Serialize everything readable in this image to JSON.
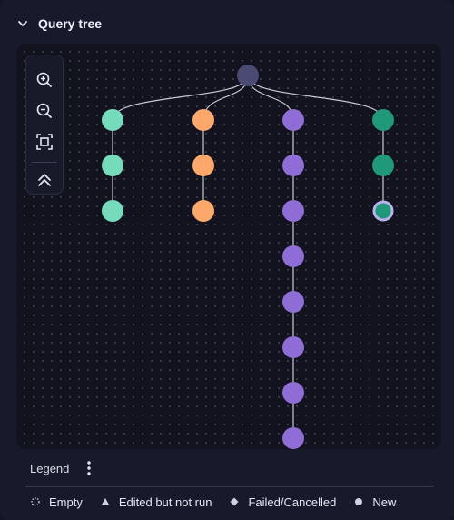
{
  "panel": {
    "title": "Query tree"
  },
  "legend": {
    "title": "Legend",
    "items": [
      {
        "key": "empty",
        "label": "Empty",
        "icon": "dotted-circle-icon"
      },
      {
        "key": "edited",
        "label": "Edited but not run",
        "icon": "triangle-icon"
      },
      {
        "key": "failed",
        "label": "Failed/Cancelled",
        "icon": "diamond-icon"
      },
      {
        "key": "new",
        "label": "New",
        "icon": "filled-circle-icon"
      }
    ]
  },
  "toolbar": {
    "tools": [
      "zoom-in-icon",
      "zoom-out-icon",
      "fit-view-icon",
      "collapse-all-icon"
    ]
  },
  "colors": {
    "background": "#181a2b",
    "canvas": "#12131e",
    "root_node": "#4a4a73",
    "branch_teal": "#76dbbb",
    "branch_orange": "#fca86a",
    "branch_purple": "#8e6ed6",
    "branch_green": "#20987a",
    "selected_ring": "#b9b2ef",
    "edge": "#c9c9d6"
  },
  "tree": {
    "root": {
      "id": "root"
    },
    "branches": [
      {
        "id": "b1",
        "color": "#76dbbb",
        "node_count": 3
      },
      {
        "id": "b2",
        "color": "#fca86a",
        "node_count": 3
      },
      {
        "id": "b3",
        "color": "#8e6ed6",
        "node_count": 8
      },
      {
        "id": "b4",
        "color": "#20987a",
        "node_count": 3,
        "selected_last": true
      }
    ]
  }
}
